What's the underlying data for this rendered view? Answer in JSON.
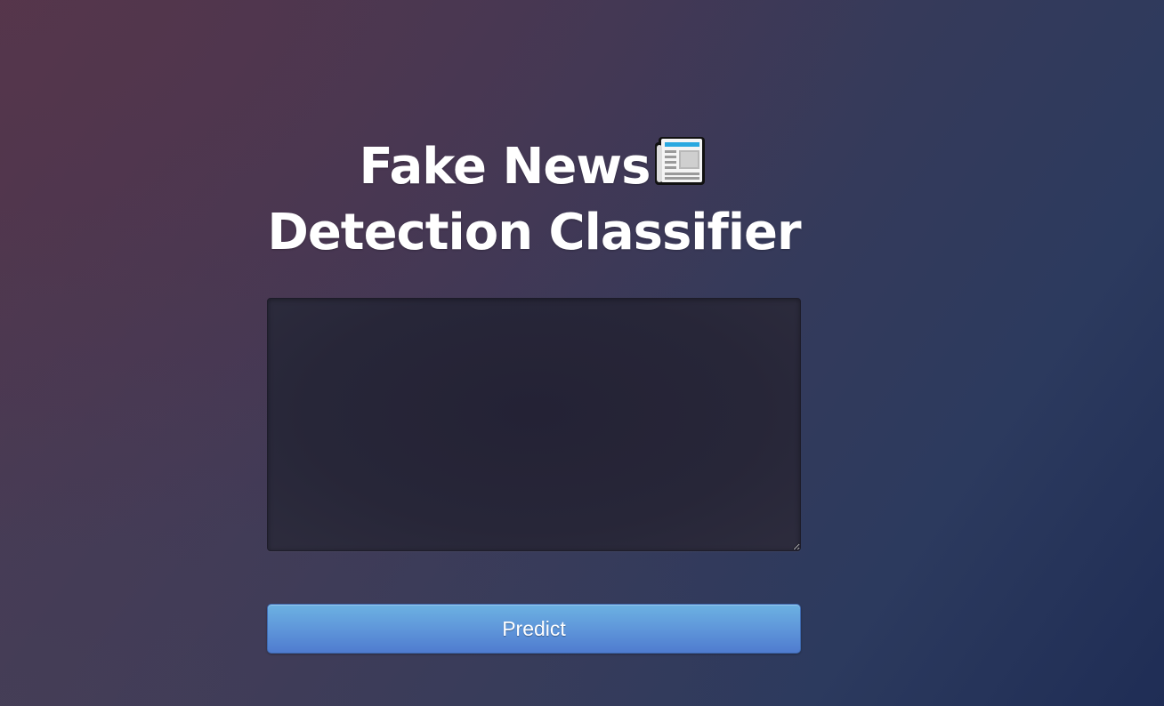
{
  "page": {
    "title_line1": "Fake News",
    "title_icon": "newspaper-icon",
    "title_line2": "Detection Classifier"
  },
  "form": {
    "textarea_value": "",
    "predict_label": "Predict"
  },
  "colors": {
    "button_top": "#6cb2e2",
    "button_bottom": "#4f7ccf",
    "background_left": "#50374e",
    "background_right": "#1f2d55"
  }
}
